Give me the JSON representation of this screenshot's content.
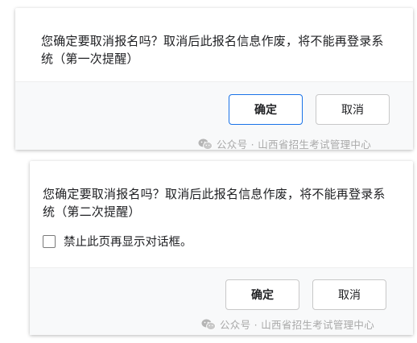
{
  "dialog_first": {
    "message": "您确定要取消报名吗？取消后此报名信息作废，将不能再登录系统（第一次提醒）",
    "ok_label": "确定",
    "cancel_label": "取消"
  },
  "dialog_second": {
    "message": "您确定要取消报名吗？取消后此报名信息作废，将不能再登录系统（第二次提醒）",
    "checkbox_label": "禁止此页再显示对话框。",
    "checkbox_checked": false,
    "ok_label": "确定",
    "cancel_label": "取消"
  },
  "watermark": {
    "text": "公众号 · 山西省招生考试管理中心",
    "icon": "wechat-icon"
  },
  "colors": {
    "focus_border": "#1a73e8",
    "footer_bg": "#f8f9fa",
    "watermark_text": "#a9a9a9"
  }
}
